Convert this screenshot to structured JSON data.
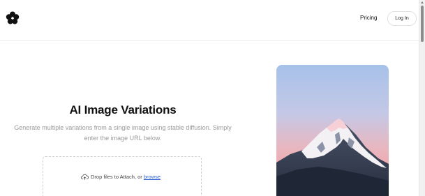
{
  "header": {
    "nav": {
      "pricing": "Pricing",
      "login": "Log In"
    }
  },
  "hero": {
    "title": "AI Image Variations",
    "subtitle": "Generate multiple variations from a single image using stable diffusion. Simply enter the image URL below."
  },
  "dropzone": {
    "text": "Drop files to Attach, or",
    "browse": "browse",
    "icon": "cloud-upload-icon"
  },
  "icons": {
    "logo": "flower-logo-icon"
  },
  "colors": {
    "link": "#2a5bd7",
    "subtitle": "#9a9a9a",
    "sky_top": "#a9c3e8",
    "sky_bottom": "#e7a2a8"
  }
}
